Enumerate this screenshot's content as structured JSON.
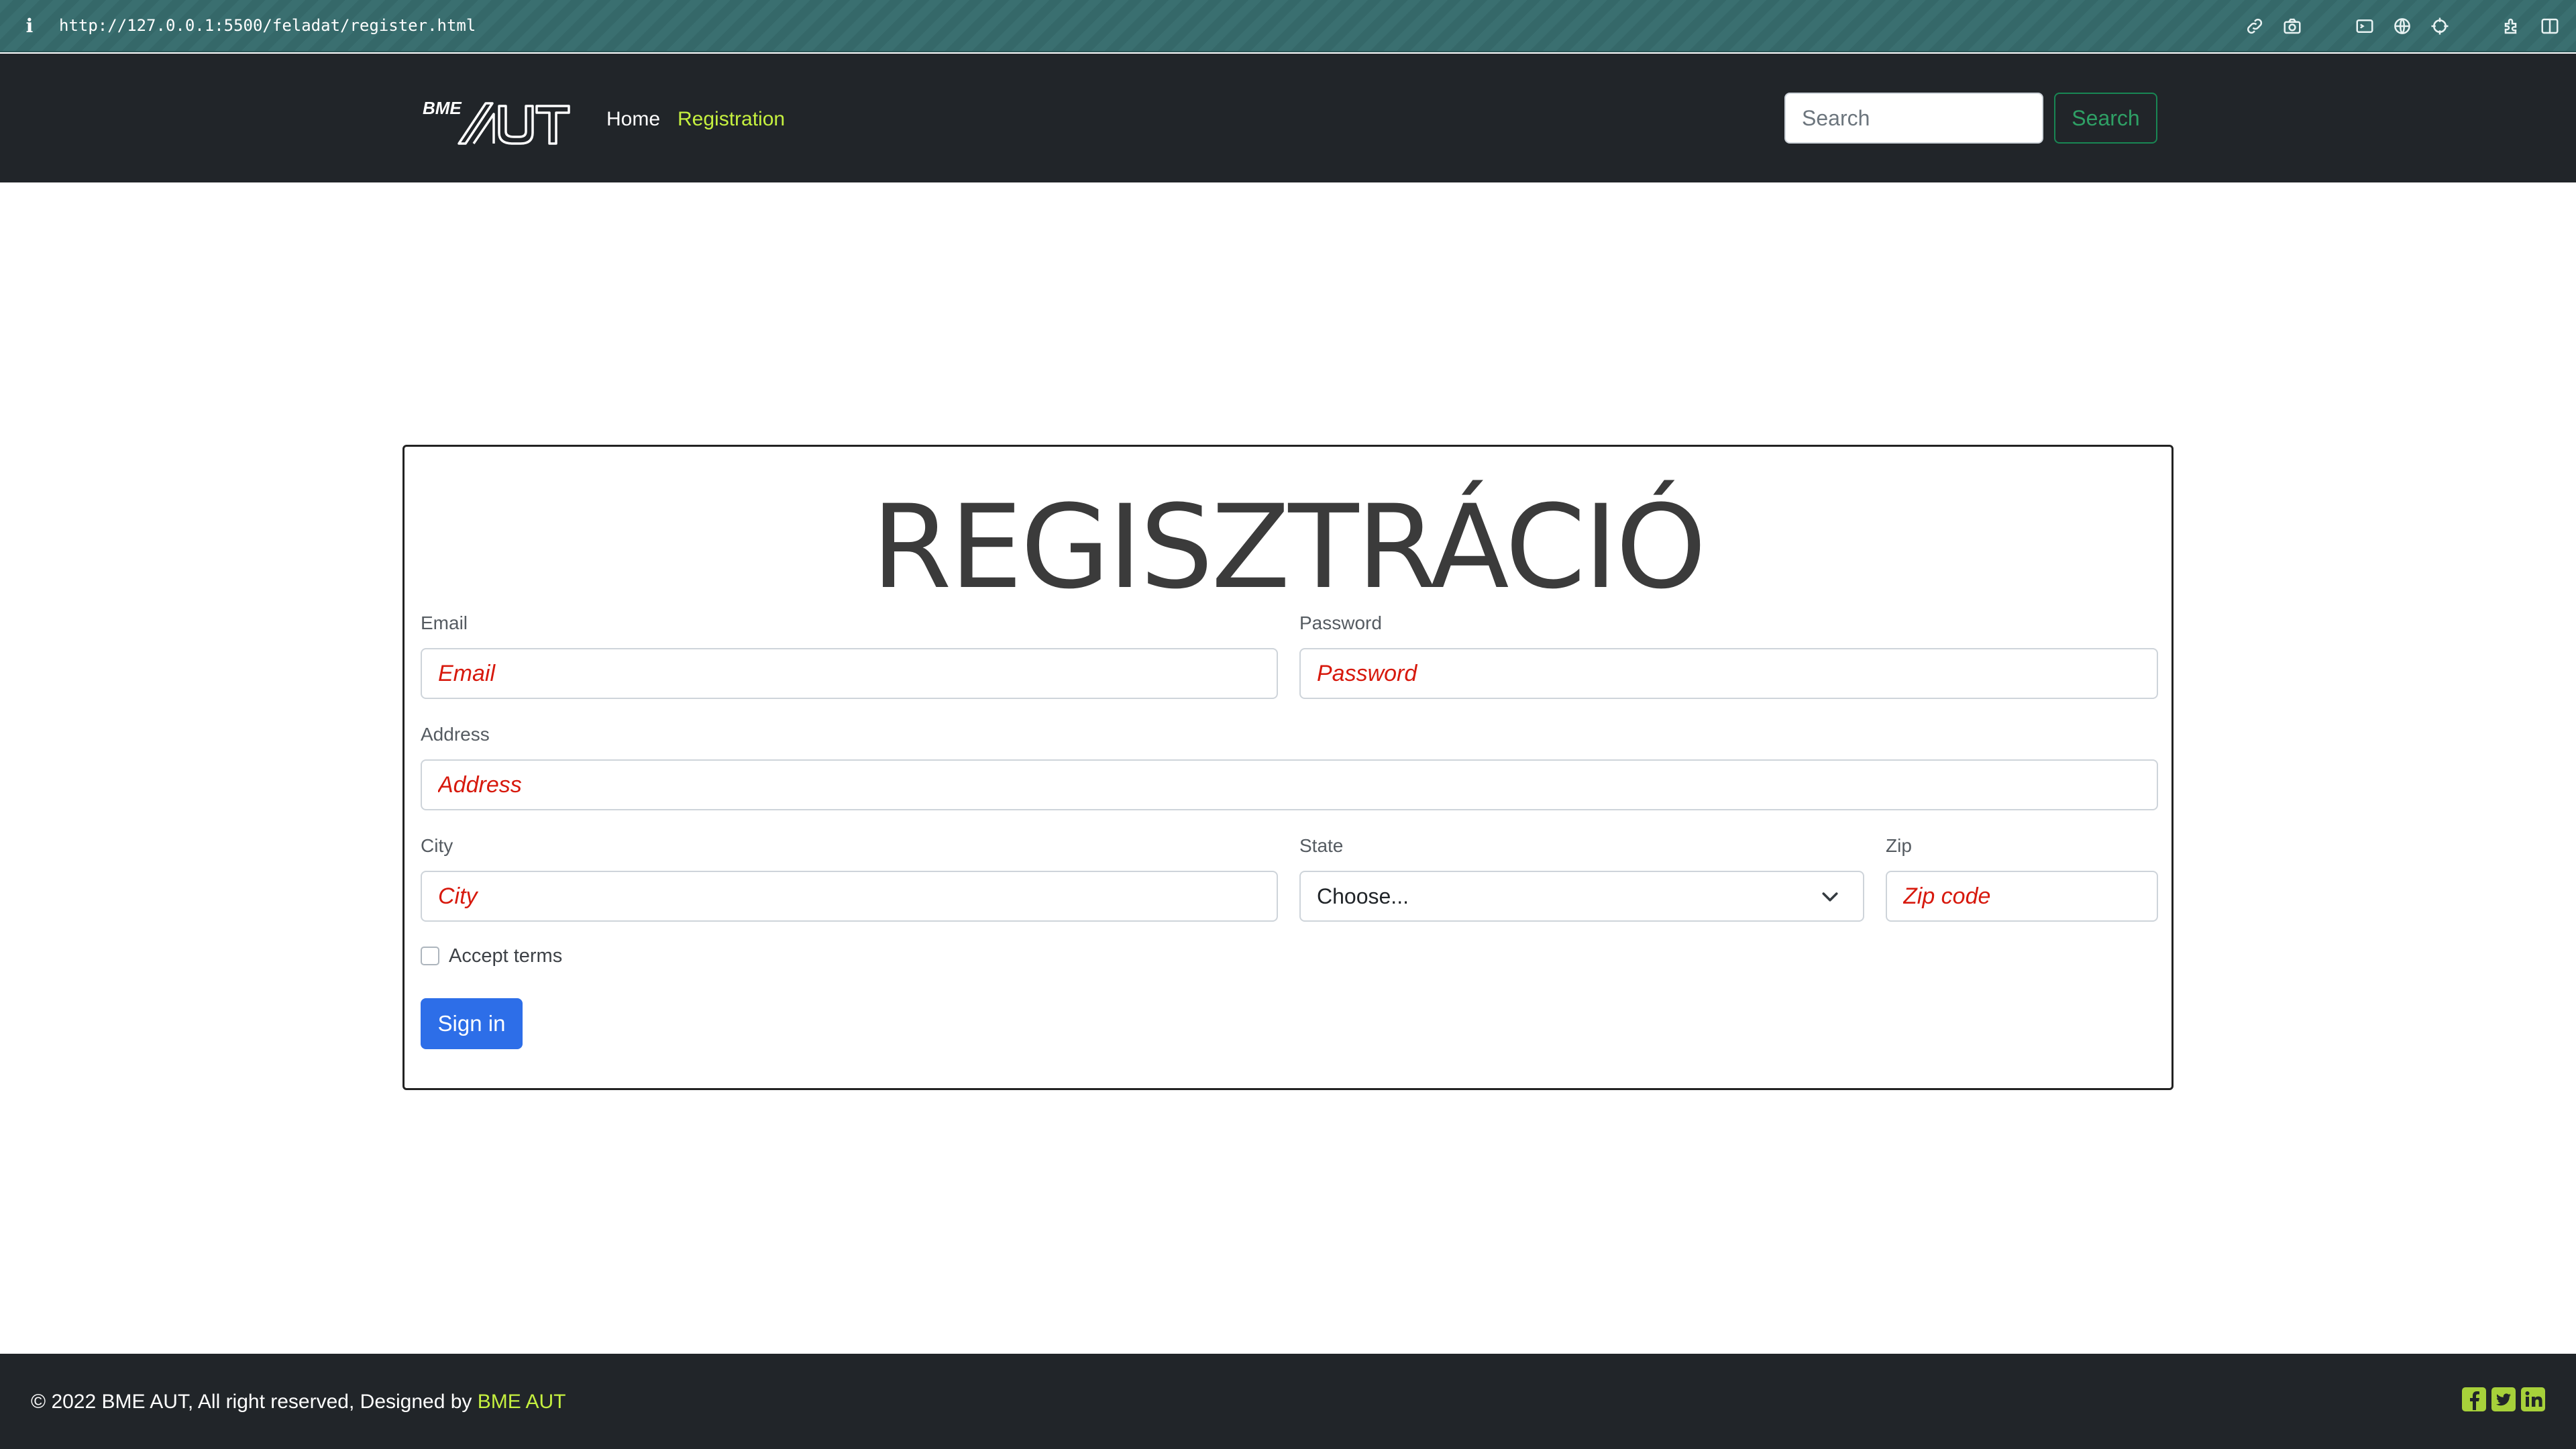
{
  "browser": {
    "url": "http://127.0.0.1:5500/feladat/register.html",
    "info_icon": "info-icon",
    "toolbar_icons": [
      "link-icon",
      "camera-icon",
      "terminal-icon",
      "globe-icon",
      "crosshair-icon",
      "extension-icon",
      "sidebar-icon"
    ]
  },
  "navbar": {
    "brand_small": "BME",
    "brand_large": "AUT",
    "links": [
      {
        "label": "Home",
        "active": false
      },
      {
        "label": "Registration",
        "active": true
      }
    ],
    "search": {
      "placeholder": "Search",
      "button_label": "Search"
    }
  },
  "form": {
    "title": "REGISZTRÁCIÓ",
    "email": {
      "label": "Email",
      "placeholder": "Email"
    },
    "password": {
      "label": "Password",
      "placeholder": "Password"
    },
    "address": {
      "label": "Address",
      "placeholder": "Address"
    },
    "city": {
      "label": "City",
      "placeholder": "City"
    },
    "state": {
      "label": "State",
      "selected": "Choose..."
    },
    "zip": {
      "label": "Zip",
      "placeholder": "Zip code"
    },
    "terms": {
      "label": "Accept terms",
      "checked": false
    },
    "submit_label": "Sign in"
  },
  "footer": {
    "text": "© 2022 BME AUT, All right reserved, Designed by",
    "link_label": "BME AUT",
    "social_icons": [
      "facebook-icon",
      "twitter-icon",
      "linkedin-icon"
    ]
  },
  "colors": {
    "nav_bg": "#212529",
    "accent_green": "#c5f03f",
    "placeholder_red": "#d7190d",
    "primary_blue": "#2d6ee8",
    "search_green": "#198754"
  }
}
